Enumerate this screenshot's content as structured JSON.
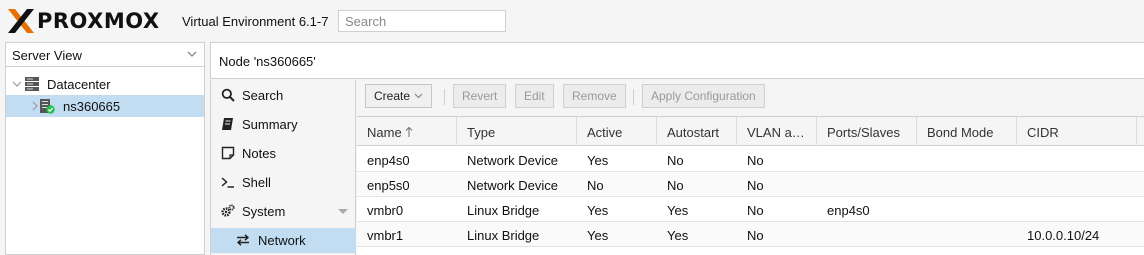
{
  "app": {
    "logo_text": "PROXMOX",
    "version": "Virtual Environment 6.1-7",
    "search_placeholder": "Search",
    "brand_color": "#e57000"
  },
  "resource_tree": {
    "view": "Server View",
    "items": [
      {
        "label": "Datacenter",
        "icon": "datacenter-icon"
      },
      {
        "label": "ns360665",
        "icon": "node-online-icon",
        "selected": true
      }
    ]
  },
  "node": {
    "title": "Node 'ns360665'"
  },
  "node_menu": {
    "items": [
      {
        "label": "Search",
        "icon": "search-icon"
      },
      {
        "label": "Summary",
        "icon": "book-icon"
      },
      {
        "label": "Notes",
        "icon": "note-icon"
      },
      {
        "label": "Shell",
        "icon": "terminal-icon"
      },
      {
        "label": "System",
        "icon": "cogs-icon",
        "expandable": true
      },
      {
        "label": "Network",
        "icon": "exchange-icon",
        "selected": true
      }
    ]
  },
  "toolbar": {
    "create": "Create",
    "revert": "Revert",
    "edit": "Edit",
    "remove": "Remove",
    "apply": "Apply Configuration"
  },
  "grid": {
    "columns": [
      "Name",
      "Type",
      "Active",
      "Autostart",
      "VLAN a…",
      "Ports/Slaves",
      "Bond Mode",
      "CIDR"
    ],
    "sort_column": "Name",
    "rows": [
      [
        "enp4s0",
        "Network Device",
        "Yes",
        "No",
        "No",
        "",
        "",
        ""
      ],
      [
        "enp5s0",
        "Network Device",
        "No",
        "No",
        "No",
        "",
        "",
        ""
      ],
      [
        "vmbr0",
        "Linux Bridge",
        "Yes",
        "Yes",
        "No",
        "enp4s0",
        "",
        ""
      ],
      [
        "vmbr1",
        "Linux Bridge",
        "Yes",
        "Yes",
        "No",
        "",
        "",
        "10.0.0.10/24"
      ]
    ]
  }
}
